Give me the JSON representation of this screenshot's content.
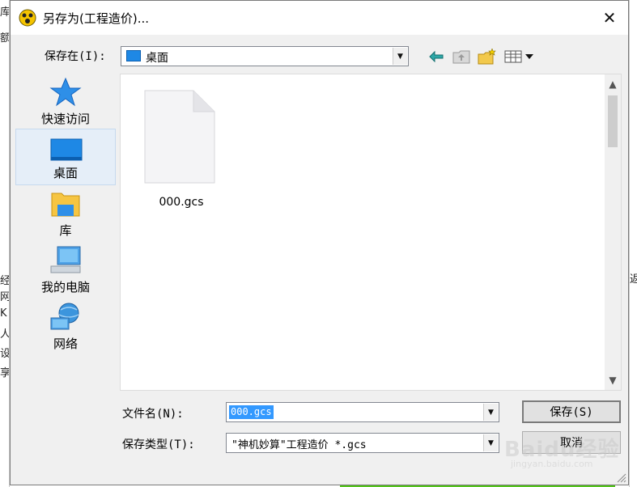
{
  "window": {
    "title": "另存为(工程造价)...",
    "close_glyph": "✕"
  },
  "save_in": {
    "label": "保存在(I):",
    "value": "桌面"
  },
  "places": [
    {
      "label": "快速访问",
      "icon": "star-icon"
    },
    {
      "label": "桌面",
      "icon": "desktop-icon",
      "selected": true
    },
    {
      "label": "库",
      "icon": "library-icon"
    },
    {
      "label": "我的电脑",
      "icon": "computer-icon"
    },
    {
      "label": "网络",
      "icon": "network-icon"
    }
  ],
  "files": [
    {
      "name": "000.gcs"
    }
  ],
  "file_name": {
    "label": "文件名(N):",
    "value": "000.gcs"
  },
  "file_type": {
    "label": "保存类型(T):",
    "value": "\"神机妙算\"工程造价 *.gcs"
  },
  "buttons": {
    "save": "保存(S)",
    "cancel": "取消"
  },
  "watermark": {
    "brand": "Baidu经验",
    "url": "jingyan.baidu.com"
  },
  "background": {
    "left_chars": [
      "库",
      "额",
      "经",
      "网",
      "K",
      "人",
      "设",
      "享"
    ],
    "right_chars": [
      "返"
    ]
  },
  "colors": {
    "selection": "#3399ff",
    "folder_blue": "#1e88e5",
    "star_blue": "#2e8fe8"
  }
}
